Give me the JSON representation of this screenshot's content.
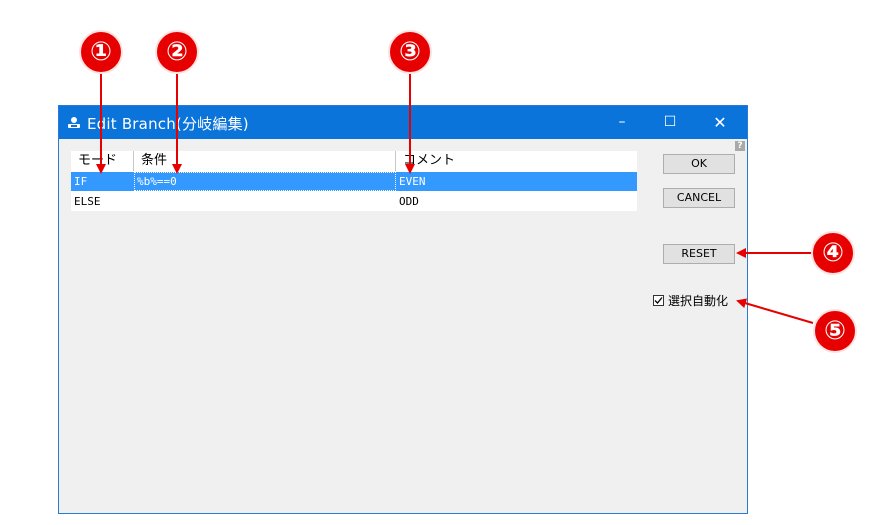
{
  "window": {
    "title": "Edit Branch(分岐編集)",
    "controls": {
      "minimize": "–",
      "maximize": "☐",
      "close": "✕"
    },
    "help": "?"
  },
  "table": {
    "headers": [
      "モード",
      "条件",
      "コメント"
    ],
    "rows": [
      {
        "mode": "IF",
        "condition": "%b%==0",
        "comment": "EVEN",
        "selected": true
      },
      {
        "mode": "ELSE",
        "condition": "",
        "comment": "ODD",
        "selected": false
      }
    ]
  },
  "buttons": {
    "ok": "OK",
    "cancel": "CANCEL",
    "reset": "RESET"
  },
  "checkbox": {
    "label": "選択自動化",
    "checked": true,
    "mark": "✓"
  },
  "callouts": [
    "①",
    "②",
    "③",
    "④",
    "⑤"
  ],
  "colors": {
    "titlebar": "#0a74da",
    "selection": "#3399ff",
    "callout": "#e60000"
  }
}
